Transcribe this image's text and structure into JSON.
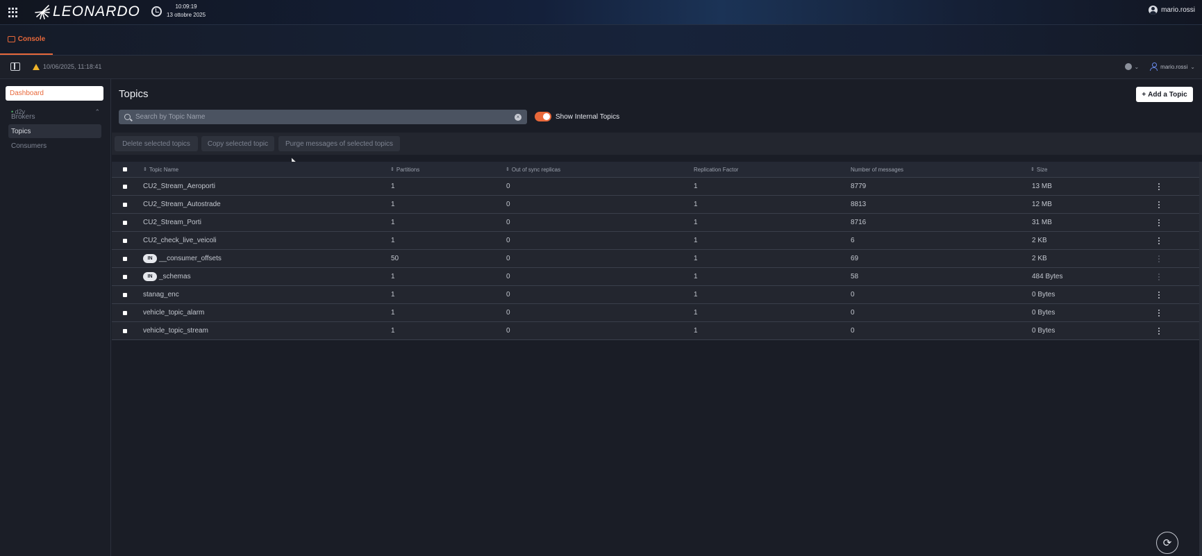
{
  "topbar": {
    "brand": "LEONARDO",
    "time": "10:09:19",
    "date": "13 ottobre 2025",
    "user": "mario.rossi"
  },
  "tabs": [
    {
      "label": "Console",
      "active": true
    }
  ],
  "subbar": {
    "warning_text": "10/06/2025, 11:18:41",
    "user": "mario.rossi"
  },
  "sidebar": {
    "dashboard_label": "Dashboard",
    "group_label": "d2v",
    "items": [
      {
        "label": "Brokers",
        "active": false
      },
      {
        "label": "Topics",
        "active": true
      },
      {
        "label": "Consumers",
        "active": false
      }
    ]
  },
  "main": {
    "title": "Topics",
    "add_button": "Add a Topic",
    "search_placeholder": "Search by Topic Name",
    "search_value": "",
    "toggle_label": "Show Internal Topics",
    "toggle_on": true,
    "actions": {
      "delete": "Delete selected topics",
      "copy": "Copy selected topic",
      "purge": "Purge messages of selected topics"
    }
  },
  "table": {
    "columns": {
      "name": "Topic Name",
      "partitions": "Partitions",
      "oos": "Out of sync replicas",
      "rf": "Replication Factor",
      "messages": "Number of messages",
      "size": "Size"
    },
    "internal_badge": "IN",
    "rows": [
      {
        "name": "CU2_Stream_Aeroporti",
        "internal": false,
        "partitions": "1",
        "oos": "0",
        "rf": "1",
        "messages": "8779",
        "size": "13 MB"
      },
      {
        "name": "CU2_Stream_Autostrade",
        "internal": false,
        "partitions": "1",
        "oos": "0",
        "rf": "1",
        "messages": "8813",
        "size": "12 MB"
      },
      {
        "name": "CU2_Stream_Porti",
        "internal": false,
        "partitions": "1",
        "oos": "0",
        "rf": "1",
        "messages": "8716",
        "size": "31 MB"
      },
      {
        "name": "CU2_check_live_veicoli",
        "internal": false,
        "partitions": "1",
        "oos": "0",
        "rf": "1",
        "messages": "6",
        "size": "2 KB"
      },
      {
        "name": "__consumer_offsets",
        "internal": true,
        "partitions": "50",
        "oos": "0",
        "rf": "1",
        "messages": "69",
        "size": "2 KB"
      },
      {
        "name": "_schemas",
        "internal": true,
        "partitions": "1",
        "oos": "0",
        "rf": "1",
        "messages": "58",
        "size": "484 Bytes"
      },
      {
        "name": "stanag_enc",
        "internal": false,
        "partitions": "1",
        "oos": "0",
        "rf": "1",
        "messages": "0",
        "size": "0 Bytes"
      },
      {
        "name": "vehicle_topic_alarm",
        "internal": false,
        "partitions": "1",
        "oos": "0",
        "rf": "1",
        "messages": "0",
        "size": "0 Bytes"
      },
      {
        "name": "vehicle_topic_stream",
        "internal": false,
        "partitions": "1",
        "oos": "0",
        "rf": "1",
        "messages": "0",
        "size": "0 Bytes"
      }
    ]
  },
  "colors": {
    "accent": "#e8683a",
    "background": "#1a1d26",
    "warning": "#f0b429"
  }
}
